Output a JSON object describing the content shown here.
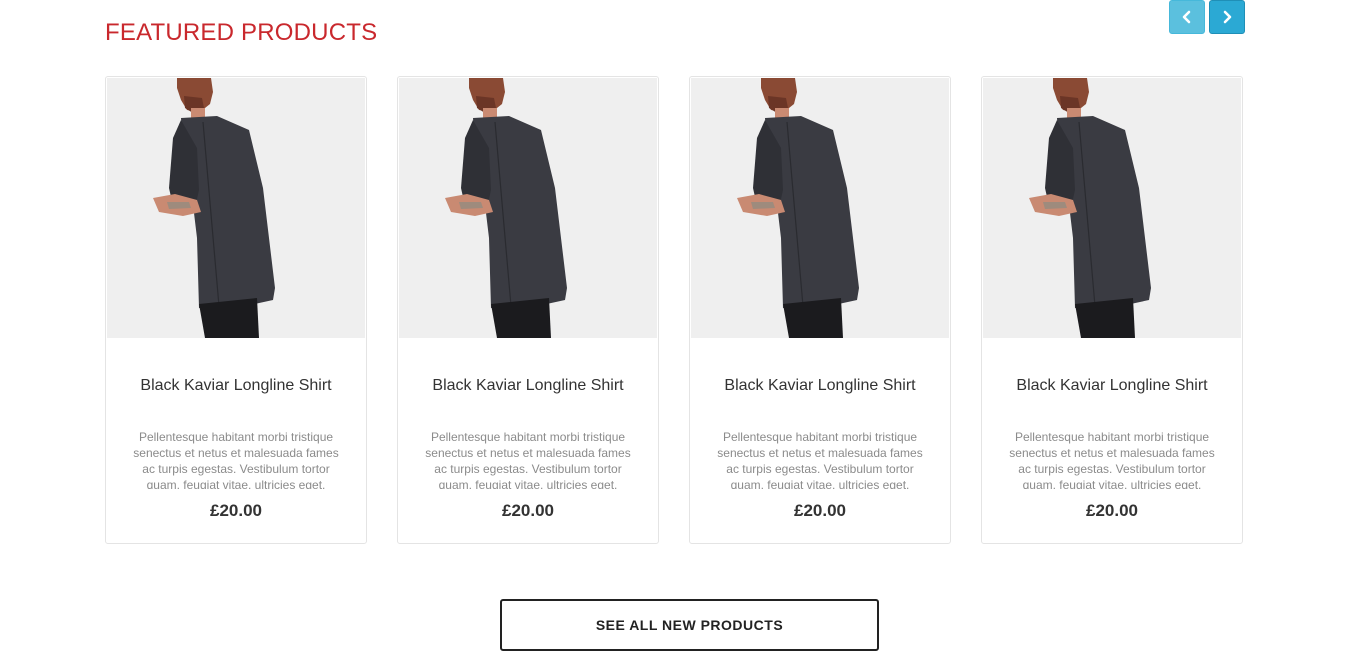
{
  "section": {
    "title": "FEATURED PRODUCTS"
  },
  "carousel": {
    "prev_icon": "chevron-left-icon",
    "next_icon": "chevron-right-icon",
    "prev_color": "#5bc0de",
    "next_color": "#2ba9d4"
  },
  "products": [
    {
      "title": "Black Kaviar Longline Shirt",
      "description": "Pellentesque habitant morbi tristique senectus et netus et malesuada fames ac turpis egestas. Vestibulum tortor quam, feugiat vitae, ultricies eget.",
      "price": "£20.00"
    },
    {
      "title": "Black Kaviar Longline Shirt",
      "description": "Pellentesque habitant morbi tristique senectus et netus et malesuada fames ac turpis egestas. Vestibulum tortor quam, feugiat vitae, ultricies eget.",
      "price": "£20.00"
    },
    {
      "title": "Black Kaviar Longline Shirt",
      "description": "Pellentesque habitant morbi tristique senectus et netus et malesuada fames ac turpis egestas. Vestibulum tortor quam, feugiat vitae, ultricies eget.",
      "price": "£20.00"
    },
    {
      "title": "Black Kaviar Longline Shirt",
      "description": "Pellentesque habitant morbi tristique senectus et netus et malesuada fames ac turpis egestas. Vestibulum tortor quam, feugiat vitae, ultricies eget.",
      "price": "£20.00"
    }
  ],
  "cta": {
    "label": "SEE ALL NEW PRODUCTS"
  },
  "colors": {
    "title_red": "#c9282d",
    "shirt": "#3a3b42"
  }
}
